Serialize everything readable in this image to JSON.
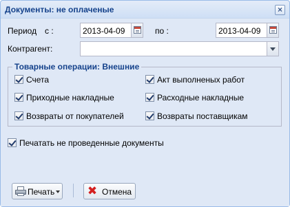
{
  "window": {
    "title": "Документы: не оплаченые",
    "close_icon": "close-icon"
  },
  "period": {
    "label": "Период",
    "from_label": "с :",
    "from_value": "2013-04-09",
    "to_label": "по :",
    "to_value": "2013-04-09",
    "calendar_icon": "calendar-icon"
  },
  "counterparty": {
    "label": "Контрагент:",
    "value": ""
  },
  "operations": {
    "legend": "Товарные операции: Внешние",
    "items": [
      {
        "label": "Счета",
        "checked": true
      },
      {
        "label": "Акт выполненых работ",
        "checked": true
      },
      {
        "label": "Приходные накладные",
        "checked": true
      },
      {
        "label": "Расходные накладные",
        "checked": true
      },
      {
        "label": "Возвраты от покупателей",
        "checked": true
      },
      {
        "label": "Возвраты поставщикам",
        "checked": true
      }
    ]
  },
  "print_unposted": {
    "label": "Печатать не проведенные документы",
    "checked": true
  },
  "footer": {
    "print_label": "Печать",
    "print_icon": "printer-icon",
    "cancel_label": "Отмена",
    "cancel_icon": "cancel-icon"
  },
  "colors": {
    "window_bg": "#dfe8f6",
    "title_text": "#15428b",
    "field_border": "#b5b8c8"
  }
}
